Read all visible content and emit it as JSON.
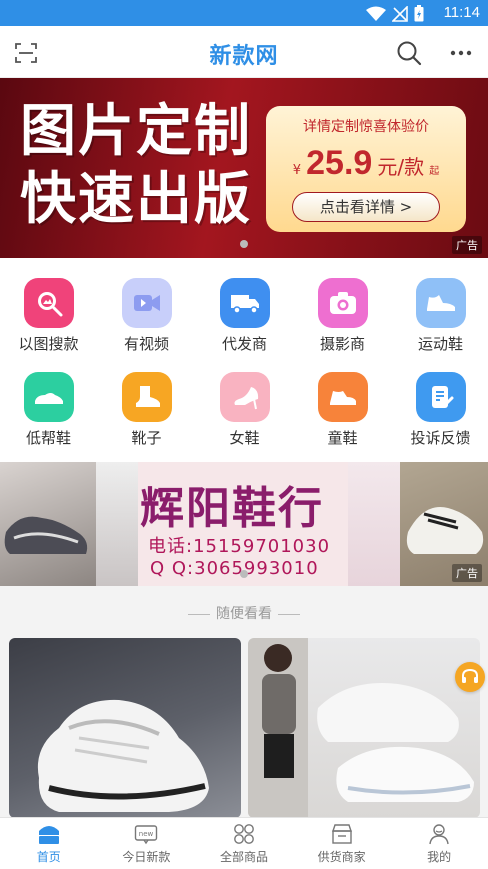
{
  "status_bar": {
    "time": "11:14"
  },
  "app_bar": {
    "title": "新款网"
  },
  "banner": {
    "line1": "图片定制",
    "line2": "快速出版",
    "card_subtitle": "详情定制惊喜体验价",
    "currency": "¥",
    "price": "25.9",
    "unit": "元/款",
    "qi": "起",
    "button_label": "点击看详情 >",
    "ad_label": "广告"
  },
  "categories": [
    {
      "label": "以图搜款",
      "icon": "image-search-icon",
      "color": "#f0437a"
    },
    {
      "label": "有视频",
      "icon": "video-icon",
      "color": "#9aa8f2"
    },
    {
      "label": "代发商",
      "icon": "delivery-truck-icon",
      "color": "#3f8ff0"
    },
    {
      "label": "摄影商",
      "icon": "camera-icon",
      "color": "#ee6fd0"
    },
    {
      "label": "运动鞋",
      "icon": "sneaker-icon",
      "color": "#6aaaf3"
    },
    {
      "label": "低帮鞋",
      "icon": "low-shoe-icon",
      "color": "#2ccfa0"
    },
    {
      "label": "靴子",
      "icon": "boot-icon",
      "color": "#f7a623"
    },
    {
      "label": "女鞋",
      "icon": "high-heel-icon",
      "color": "#f48fa5"
    },
    {
      "label": "童鞋",
      "icon": "kids-shoe-icon",
      "color": "#f7833a"
    },
    {
      "label": "投诉反馈",
      "icon": "feedback-icon",
      "color": "#3f9af0"
    }
  ],
  "banner2": {
    "shop_name": "辉阳鞋行",
    "phone": "电话:15159701030",
    "qq": "Q Q:3065993010",
    "ad_label": "广告"
  },
  "section": {
    "title": "随便看看"
  },
  "tabbar": {
    "tabs": [
      {
        "label": "首页",
        "icon": "home-icon",
        "active": true
      },
      {
        "label": "今日新款",
        "icon": "new-badge-icon",
        "active": false
      },
      {
        "label": "全部商品",
        "icon": "grid-circles-icon",
        "active": false
      },
      {
        "label": "供货商家",
        "icon": "store-icon",
        "active": false
      },
      {
        "label": "我的",
        "icon": "profile-icon",
        "active": false
      }
    ]
  },
  "colors": {
    "accent": "#2f8fe6",
    "banner_red": "#a3161f"
  }
}
